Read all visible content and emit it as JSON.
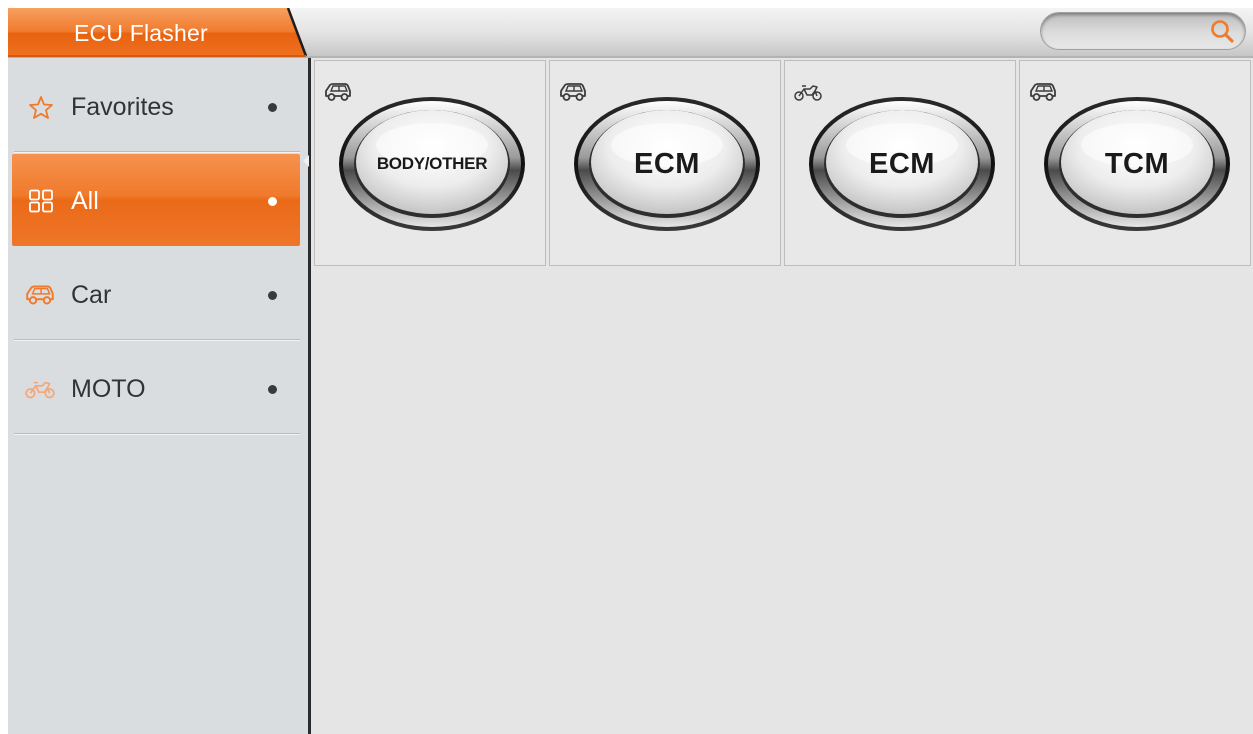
{
  "app": {
    "title": "ECU Flasher"
  },
  "search": {
    "value": "",
    "placeholder": "",
    "icon": "search-icon"
  },
  "colors": {
    "accent": "#f07a2c",
    "accent_dark": "#e45f10",
    "sidebar_bg": "#dadde0",
    "content_bg": "#e5e5e5",
    "icon_gray": "#3c3c3c"
  },
  "sidebar": {
    "items": [
      {
        "label": "Favorites",
        "icon": "star-icon",
        "active": false
      },
      {
        "label": "All",
        "icon": "grid-icon",
        "active": true
      },
      {
        "label": "Car",
        "icon": "car-icon",
        "active": false
      },
      {
        "label": "MOTO",
        "icon": "motorcycle-icon",
        "active": false
      }
    ]
  },
  "tiles": [
    {
      "label": "BODY/OTHER",
      "vehicle_icon": "car-icon"
    },
    {
      "label": "ECM",
      "vehicle_icon": "car-icon"
    },
    {
      "label": "ECM",
      "vehicle_icon": "motorcycle-icon"
    },
    {
      "label": "TCM",
      "vehicle_icon": "car-icon"
    }
  ]
}
